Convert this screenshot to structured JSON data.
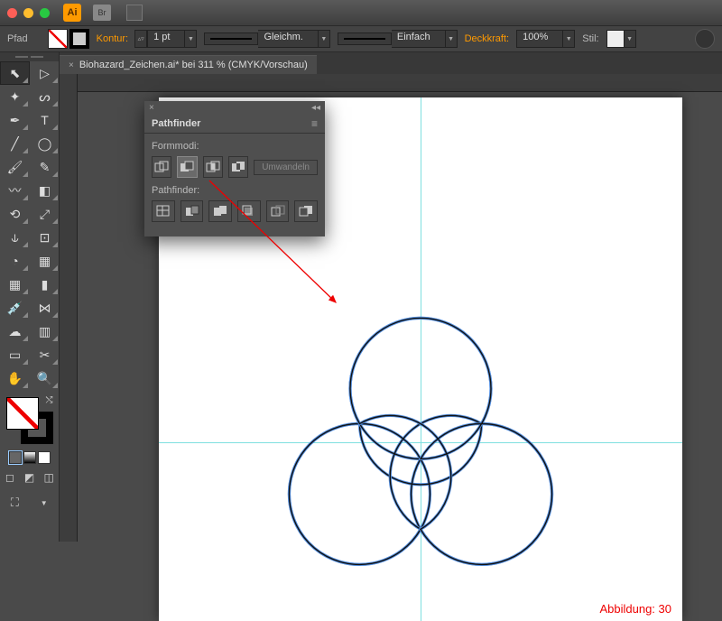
{
  "titlebar": {
    "ai": "Ai",
    "br": "Br"
  },
  "ctrl": {
    "path": "Pfad",
    "kontur": "Kontur:",
    "weight": "1 pt",
    "profile": "Gleichm.",
    "brush": "Einfach",
    "opacity_label": "Deckkraft:",
    "opacity": "100%",
    "style": "Stil:"
  },
  "tab": {
    "name": "Biohazard_Zeichen.ai* bei 311 % (CMYK/Vorschau)"
  },
  "pathfinder": {
    "title": "Pathfinder",
    "shape_label": "Formmodi:",
    "expand": "Umwandeln",
    "pf_label": "Pathfinder:"
  },
  "caption": "Abbildung: 30",
  "tools": {
    "rows": [
      [
        "selection-tool",
        "direct-selection-tool"
      ],
      [
        "magic-wand-tool",
        "lasso-tool"
      ],
      [
        "pen-tool",
        "type-tool"
      ],
      [
        "line-tool",
        "ellipse-tool"
      ],
      [
        "paintbrush-tool",
        "pencil-tool"
      ],
      [
        "blob-brush-tool",
        "eraser-tool"
      ],
      [
        "rotate-tool",
        "scale-tool"
      ],
      [
        "width-tool",
        "free-transform-tool"
      ],
      [
        "shape-builder-tool",
        "perspective-grid-tool"
      ],
      [
        "mesh-tool",
        "gradient-tool"
      ],
      [
        "eyedropper-tool",
        "blend-tool"
      ],
      [
        "symbol-sprayer-tool",
        "graph-tool"
      ],
      [
        "artboard-tool",
        "slice-tool"
      ],
      [
        "hand-tool",
        "zoom-tool"
      ]
    ],
    "glyphs": [
      [
        "⬉",
        "▷"
      ],
      [
        "✦",
        "ᔕ"
      ],
      [
        "✒",
        "T"
      ],
      [
        "╱",
        "◯"
      ],
      [
        "🖌",
        "✎"
      ],
      [
        "〰",
        "◧"
      ],
      [
        "⟲",
        "⤢"
      ],
      [
        "⫝",
        "⊡"
      ],
      [
        "◔",
        "▦"
      ],
      [
        "▦",
        "▮"
      ],
      [
        "💉",
        "⋈"
      ],
      [
        "☁",
        "▥"
      ],
      [
        "▭",
        "✂"
      ],
      [
        "✋",
        "🔍"
      ]
    ]
  }
}
